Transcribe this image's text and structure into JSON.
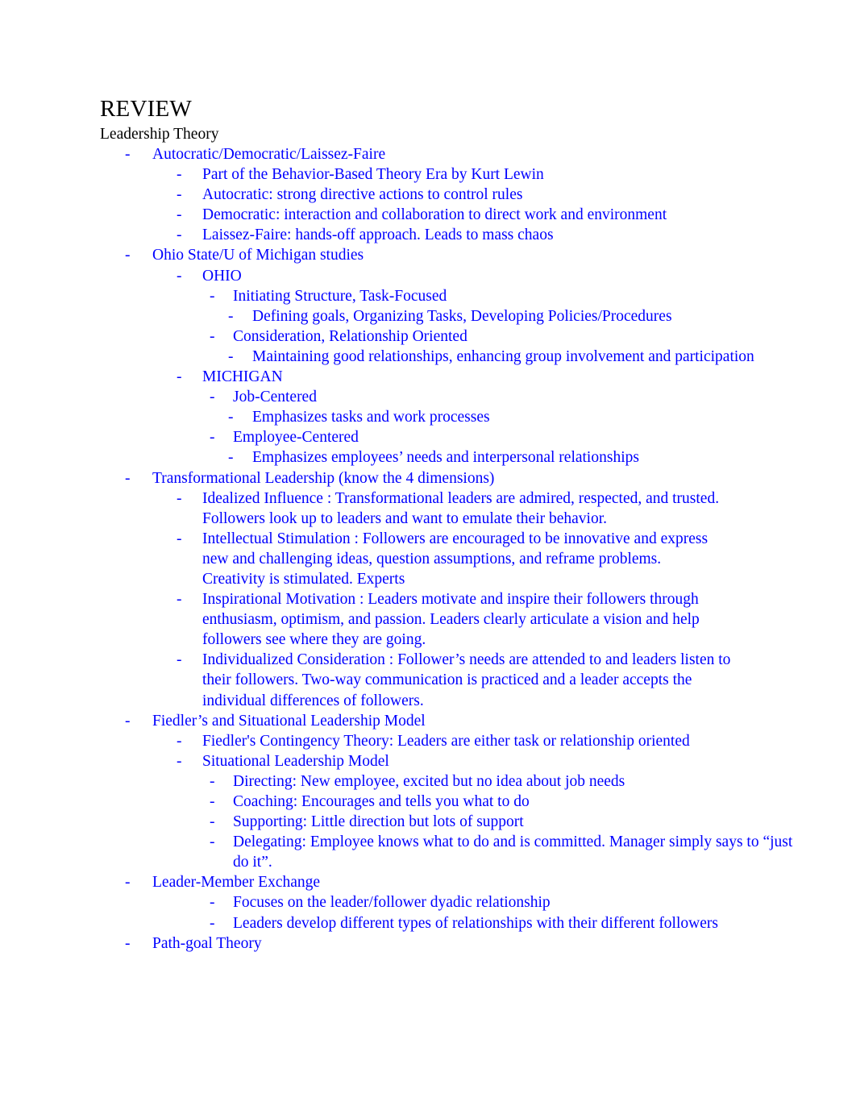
{
  "document": {
    "title": "REVIEW",
    "subtitle": "Leadership Theory"
  },
  "outline": {
    "autocratic_heading": "Autocratic/Democratic/Laissez-Faire",
    "autocratic_items": [
      "Part of the Behavior-Based Theory Era by Kurt Lewin",
      "Autocratic:   strong directive actions to control rules",
      "Democratic:   interaction and collaboration to direct work and environment",
      "Laissez-Faire:   hands-off approach. Leads to mass chaos"
    ],
    "studies_heading": "Ohio State/U of Michigan studies",
    "ohio_label": "OHIO",
    "ohio_initiating": "Initiating Structure, Task-Focused",
    "ohio_initiating_detail": "Defining goals, Organizing Tasks, Developing Policies/Procedures",
    "ohio_consideration": "Consideration, Relationship Oriented",
    "ohio_consideration_detail": "Maintaining good relationships, enhancing group involvement and participation",
    "michigan_label": "MICHIGAN",
    "michigan_job_centered": "Job-Centered",
    "michigan_job_centered_detail": "Emphasizes tasks and work processes",
    "michigan_employee_centered": "Employee-Centered",
    "michigan_employee_centered_detail": "Emphasizes employees’ needs and interpersonal relationships",
    "transformational_heading": "Transformational Leadership (know the 4 dimensions)",
    "transformational_dimensions": [
      "Idealized Influence  : Transformational leaders are admired, respected, and trusted. Followers look up to leaders and want to emulate their behavior.",
      "Intellectual Stimulation   : Followers are encouraged to be innovative and express new and challenging ideas, question assumptions, and reframe problems. Creativity is stimulated. Experts",
      "Inspirational Motivation   : Leaders motivate and inspire their followers through enthusiasm, optimism, and passion. Leaders clearly articulate a vision and help followers see where they are going.",
      "Individualized Consideration   : Follower’s needs are attended to and leaders listen to their followers. Two-way communication is practiced and a leader accepts the individual differences of followers."
    ],
    "fiedler_heading": "Fiedler’s and Situational Leadership Model",
    "fiedler_contingency": "Fiedler's Contingency Theory: Leaders are either task or relationship oriented",
    "situational_model": "Situational Leadership Model",
    "situational_styles": [
      "Directing:  New employee, excited but no idea about job needs",
      "Coaching:  Encourages and tells you what to do",
      "Supporting:   Little direction but lots of support",
      "Delegating:  Employee knows what to do and is committed. Manager simply says to “just do it”."
    ],
    "lmx_heading": "Leader-Member Exchange",
    "lmx_items": [
      "Focuses on the leader/follower dyadic relationship",
      "Leaders develop different types of relationships with their different followers"
    ],
    "path_goal_heading": "Path-goal Theory"
  },
  "bullet_marker": "-",
  "colors": {
    "body_text": "#000000",
    "detail_text": "#0000ff",
    "background": "#ffffff"
  }
}
